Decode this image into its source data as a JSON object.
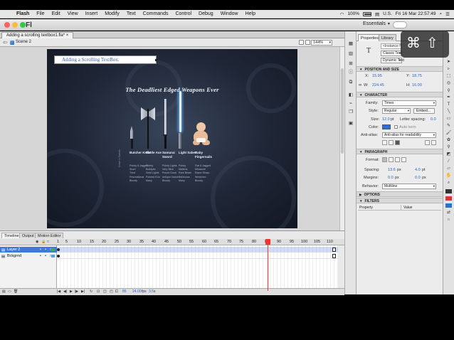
{
  "menubar": {
    "app": "Flash",
    "items": [
      "File",
      "Edit",
      "View",
      "Insert",
      "Modify",
      "Text",
      "Commands",
      "Control",
      "Debug",
      "Window",
      "Help"
    ],
    "battery": "100%",
    "input_source": "U.S.",
    "clock": "Fri 16 Mar  22:57:49"
  },
  "titlebar": {
    "logo": "Fl",
    "workspace": "Essentials"
  },
  "document": {
    "tab": "Adding a scrolling textbox1.fla*",
    "scene": "Scene 2",
    "zoom": "144%"
  },
  "stage": {
    "textbox": "Adding a Scrolling TextBox.",
    "poster_title": "The Deadliest Edged Weapons Ever",
    "weapons": [
      {
        "label": "Butcher Knife",
        "props": [
          "Pointy & Jagged",
          "Short",
          "Tried",
          "Recreational",
          "Bloody"
        ]
      },
      {
        "label": "Battle Axe",
        "props": [
          "Pointy",
          "Bulldyke",
          "Solid Lights",
          "Pointed End",
          "Many"
        ]
      },
      {
        "label": "Samurai Sword",
        "props": [
          "Pointy Lights",
          "Very Slick",
          "Priced Good",
          "Antique Name",
          "Bloody"
        ]
      },
      {
        "label": "Light Saber",
        "props": [
          "Pointy",
          "Malleus",
          "Rare Beam",
          "Bellhouse",
          "Many"
        ]
      },
      {
        "label": "Baby Fingernails",
        "props": [
          "Flat & Jagged",
          "Miniscule",
          "Razor-Sharp",
          "Wretched",
          "Bloody"
        ]
      }
    ],
    "side_note": "Come in Swords"
  },
  "properties": {
    "tabs": [
      "Properties",
      "Library"
    ],
    "instance_name": "<Instance Name>",
    "text_type": "Classic Text",
    "text_mode": "Dynamic Text",
    "sections": {
      "position": "POSITION AND SIZE",
      "character": "CHARACTER",
      "paragraph": "PARAGRAPH",
      "options": "OPTIONS",
      "filters": "FILTERS"
    },
    "x_label": "X:",
    "x_value": "15.95",
    "y_label": "Y:",
    "y_value": "18.75",
    "w_label": "W:",
    "w_value": "224.45",
    "h_label": "H:",
    "h_value": "16.00",
    "family_label": "Family:",
    "family": "Times",
    "style_label": "Style:",
    "style": "Regular",
    "embed": "Embed...",
    "size_label": "Size:",
    "size": "12.0",
    "size_unit": "pt",
    "spacing_label": "Letter spacing:",
    "letter_spacing": "0.0",
    "color_label": "Color:",
    "autokern": "Auto kern",
    "antialias_label": "Anti-alias:",
    "antialias": "Anti-alias for readability",
    "format_label": "Format:",
    "p_spacing_label": "Spacing:",
    "p_spacing_1": "13.6",
    "p_spacing_unit": "px",
    "p_spacing_2": "4.0",
    "p_spacing_unit2": "pt",
    "margins_label": "Margins:",
    "margin_1": "0.0",
    "margin_unit": "px",
    "margin_2": "0.0",
    "margin_unit2": "px",
    "behavior_label": "Behavior:",
    "behavior": "Multiline",
    "filter_col1": "Property",
    "filter_col2": "Value"
  },
  "timeline": {
    "tabs": [
      "Timeline",
      "Output",
      "Motion Editor"
    ],
    "frame_numbers": [
      "1",
      "5",
      "10",
      "15",
      "20",
      "25",
      "30",
      "35",
      "40",
      "45",
      "50",
      "55",
      "60",
      "65",
      "70",
      "75",
      "80",
      "85",
      "90",
      "95",
      "100",
      "105",
      "110"
    ],
    "layers": [
      {
        "name": "Layer 2",
        "selected": true,
        "color": "#35b34a"
      },
      {
        "name": "Bckgrnd",
        "selected": false,
        "color": "#5a9ee8"
      }
    ],
    "current_frame": "85",
    "fps": "24.00",
    "fps_unit": "fps",
    "time": "3.5",
    "time_unit": "s"
  },
  "key_overlay": {
    "cmd": "⌘",
    "shift": "⇧"
  },
  "colors": {
    "accent": "#3f7ad6",
    "playhead": "#e33333",
    "text_color_swatch": "#2f6fd0"
  }
}
